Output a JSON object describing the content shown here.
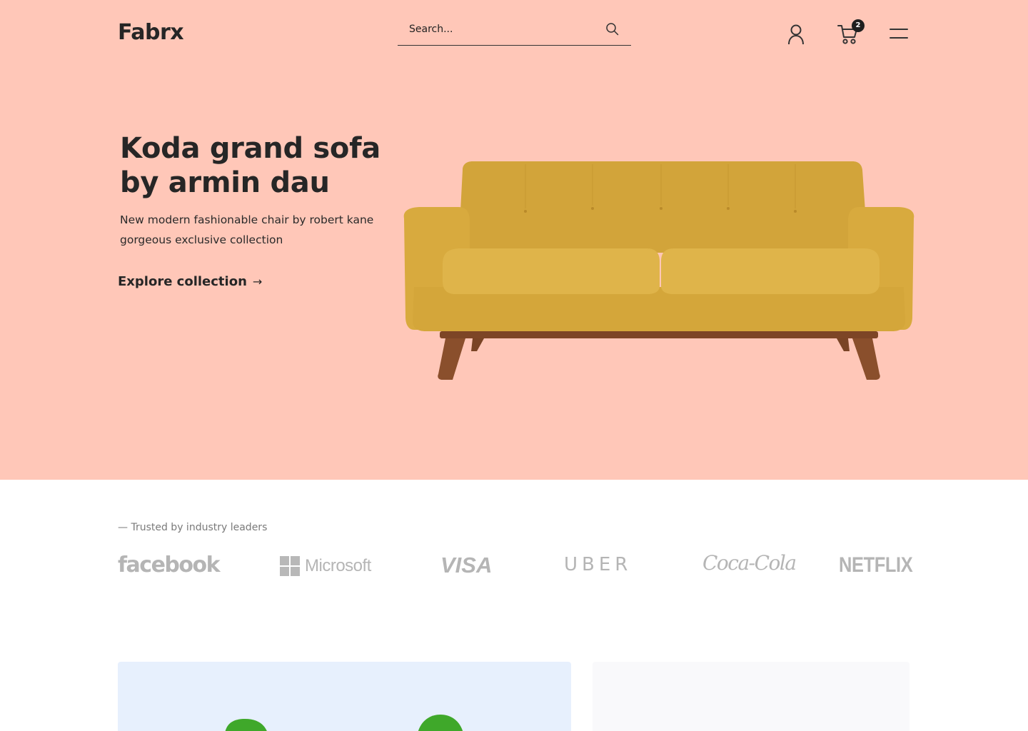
{
  "header": {
    "logo": "Fabrx",
    "search": {
      "placeholder": "Search..."
    },
    "cart_count": "2",
    "icons": [
      "search-icon",
      "user-icon",
      "cart-icon",
      "menu-icon"
    ]
  },
  "hero": {
    "title": "Koda grand sofa by armin dau",
    "subtitle": "New modern fashionable chair by robert kane gorgeous exclusive collection",
    "cta_label": "Explore collection",
    "cta_arrow": "→",
    "background": "#ffc7b8"
  },
  "trusted": {
    "label": "— Trusted by industry leaders",
    "brands": [
      {
        "name": "facebook",
        "text": "facebook"
      },
      {
        "name": "microsoft",
        "text": "Microsoft"
      },
      {
        "name": "visa",
        "text": "VISA"
      },
      {
        "name": "uber",
        "text": "UBER"
      },
      {
        "name": "coca-cola",
        "text": "Coca-Cola"
      },
      {
        "name": "netflix",
        "text": "NETFLIX"
      }
    ]
  },
  "colors": {
    "accent_text": "#262626",
    "logo_gray": "#b5b5b5",
    "card_left_bg": "#e7f0fd",
    "card_right_bg": "#f9f9fb",
    "sofa": "#d4a63a",
    "sofa_legs": "#8a4b2a",
    "chair_green": "#3fa82a"
  }
}
